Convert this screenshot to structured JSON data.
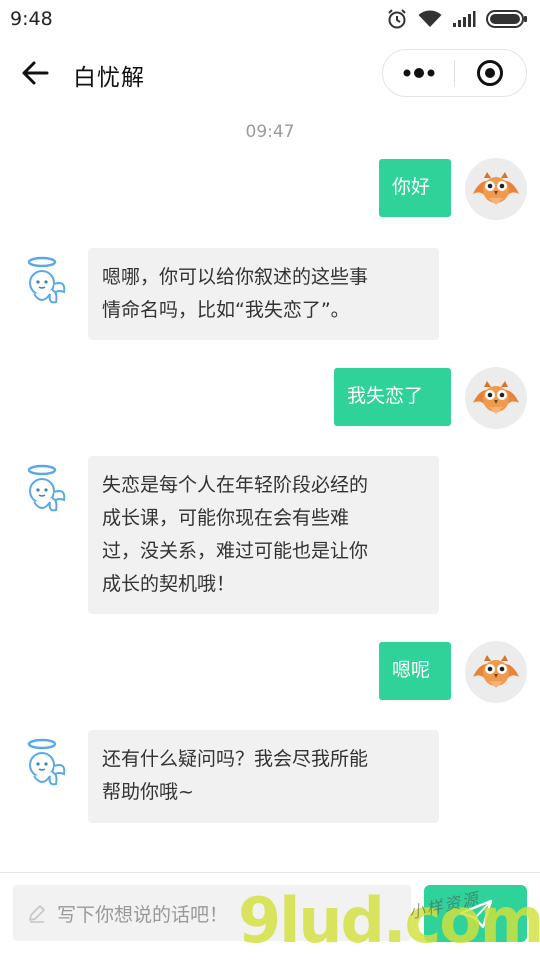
{
  "status_bar": {
    "time": "9:48"
  },
  "header": {
    "title": "白忧解"
  },
  "chat": {
    "timestamp": "09:47",
    "messages": [
      {
        "from": "user",
        "text": "你好"
      },
      {
        "from": "bot",
        "lines": [
          "嗯哪，你可以给你叙述的这些事",
          "情命名吗，比如“我失恋了”。"
        ]
      },
      {
        "from": "user",
        "text": "我失恋了"
      },
      {
        "from": "bot",
        "lines": [
          "失恋是每个人在年轻阶段必经的",
          "成长课，可能你现在会有些难",
          "过，没关系，难过可能也是让你",
          "成长的契机哦！"
        ]
      },
      {
        "from": "user",
        "text": "嗯呢"
      },
      {
        "from": "bot",
        "lines": [
          "还有什么疑问吗？我会尽我所能",
          "帮助你哦~"
        ]
      }
    ]
  },
  "input": {
    "placeholder": "写下你想说的话吧！"
  },
  "watermark": {
    "main": "9lud.com",
    "sub": "小样资源"
  },
  "colors": {
    "accent": "#2fd39a",
    "bot_bubble": "#f1f1f1"
  }
}
